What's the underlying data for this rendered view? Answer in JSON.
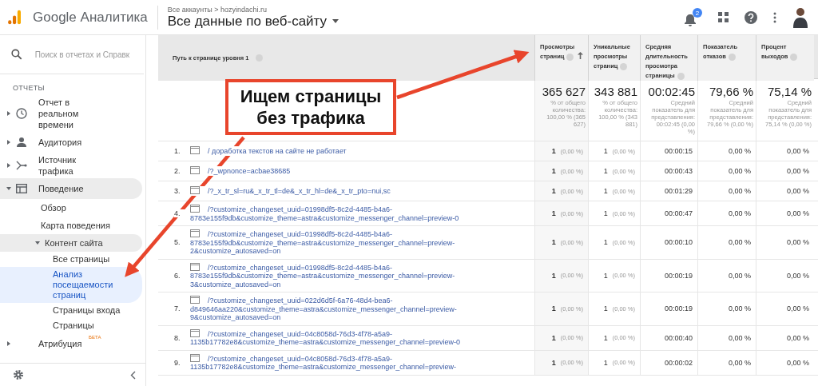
{
  "header": {
    "product": "Google Аналитика",
    "breadcrumb": "Все аккаунты > hozyindachi.ru",
    "view": "Все данные по веб-сайту",
    "notifications": "2"
  },
  "sidebar": {
    "search_placeholder": "Поиск в отчетах и Справк",
    "section": "ОТЧЕТЫ",
    "items": [
      {
        "label": "Отчет в реальном времени",
        "expanded": false,
        "selected": false
      },
      {
        "label": "Аудитория",
        "expanded": false,
        "selected": false
      },
      {
        "label": "Источник трафика",
        "expanded": false,
        "selected": false
      },
      {
        "label": "Поведение",
        "expanded": true,
        "selected": false,
        "children": [
          {
            "label": "Обзор",
            "expanded": false,
            "selected": false
          },
          {
            "label": "Карта поведения",
            "expanded": false,
            "selected": false
          },
          {
            "label": "Контент сайта",
            "expanded": true,
            "selected": false,
            "children": [
              {
                "label": "Все страницы",
                "selected": false
              },
              {
                "label": "Анализ посещаемости страниц",
                "selected": true
              },
              {
                "label": "Страницы входа",
                "selected": false
              },
              {
                "label": "Страницы",
                "selected": false
              }
            ]
          }
        ]
      },
      {
        "label": "Атрибуция",
        "badge": "БЕТА",
        "expanded": false,
        "selected": false
      }
    ]
  },
  "table": {
    "columns": [
      {
        "label": "Путь к странице уровня 1",
        "sorted": false
      },
      {
        "label": "Просмотры страниц",
        "sorted": true
      },
      {
        "label": "Уникальные просмотры страниц",
        "sorted": false
      },
      {
        "label": "Средняя длительность просмотра страницы",
        "sorted": false
      },
      {
        "label": "Показатель отказов",
        "sorted": false
      },
      {
        "label": "Процент выходов",
        "sorted": false
      }
    ],
    "totals": [
      {
        "value": "365 627",
        "note": "% от общего количества: 100,00 % (365 627)"
      },
      {
        "value": "343 881",
        "note": "% от общего количества: 100,00 % (343 881)"
      },
      {
        "value": "00:02:45",
        "note": "Средний показатель для представления: 00:02:45 (0,00 %)"
      },
      {
        "value": "79,66 %",
        "note": "Средний показатель для представления: 79,66 % (0,00 %)"
      },
      {
        "value": "75,14 %",
        "note": "Средний показатель для представления: 75,14 % (0,00 %)"
      }
    ],
    "rows": [
      {
        "index": "1.",
        "path": "/ доработка текстов на сайте не работает",
        "views": "1",
        "views_pct": "(0,00 %)",
        "unique": "1",
        "unique_pct": "(0,00 %)",
        "avg_time": "00:00:15",
        "bounce": "0,00 %",
        "exit": "0,00 %"
      },
      {
        "index": "2.",
        "path": "/?_wpnonce=acbae38685",
        "views": "1",
        "views_pct": "(0,00 %)",
        "unique": "1",
        "unique_pct": "(0,00 %)",
        "avg_time": "00:00:43",
        "bounce": "0,00 %",
        "exit": "0,00 %"
      },
      {
        "index": "3.",
        "path": "/?_x_tr_sl=ru&_x_tr_tl=de&_x_tr_hl=de&_x_tr_pto=nui,sc",
        "views": "1",
        "views_pct": "(0,00 %)",
        "unique": "1",
        "unique_pct": "(0,00 %)",
        "avg_time": "00:01:29",
        "bounce": "0,00 %",
        "exit": "0,00 %"
      },
      {
        "index": "4.",
        "path": "/?customize_changeset_uuid=01998df5-8c2d-4485-b4a6-8783e155f9db&customize_theme=astra&customize_messenger_channel=preview-0",
        "views": "1",
        "views_pct": "(0,00 %)",
        "unique": "1",
        "unique_pct": "(0,00 %)",
        "avg_time": "00:00:47",
        "bounce": "0,00 %",
        "exit": "0,00 %"
      },
      {
        "index": "5.",
        "path": "/?customize_changeset_uuid=01998df5-8c2d-4485-b4a6-8783e155f9db&customize_theme=astra&customize_messenger_channel=preview-2&customize_autosaved=on",
        "views": "1",
        "views_pct": "(0,00 %)",
        "unique": "1",
        "unique_pct": "(0,00 %)",
        "avg_time": "00:00:10",
        "bounce": "0,00 %",
        "exit": "0,00 %"
      },
      {
        "index": "6.",
        "path": "/?customize_changeset_uuid=01998df5-8c2d-4485-b4a6-8783e155f9db&customize_theme=astra&customize_messenger_channel=preview-3&customize_autosaved=on",
        "views": "1",
        "views_pct": "(0,00 %)",
        "unique": "1",
        "unique_pct": "(0,00 %)",
        "avg_time": "00:00:19",
        "bounce": "0,00 %",
        "exit": "0,00 %"
      },
      {
        "index": "7.",
        "path": "/?customize_changeset_uuid=022d6d5f-6a76-48d4-bea6-d849646aa220&customize_theme=astra&customize_messenger_channel=preview-9&customize_autosaved=on",
        "views": "1",
        "views_pct": "(0,00 %)",
        "unique": "1",
        "unique_pct": "(0,00 %)",
        "avg_time": "00:00:19",
        "bounce": "0,00 %",
        "exit": "0,00 %"
      },
      {
        "index": "8.",
        "path": "/?customize_changeset_uuid=04c8058d-76d3-4f78-a5a9-1135b17782e8&customize_theme=astra&customize_messenger_channel=preview-0",
        "views": "1",
        "views_pct": "(0,00 %)",
        "unique": "1",
        "unique_pct": "(0,00 %)",
        "avg_time": "00:00:40",
        "bounce": "0,00 %",
        "exit": "0,00 %"
      },
      {
        "index": "9.",
        "path": "/?customize_changeset_uuid=04c8058d-76d3-4f78-a5a9-1135b17782e8&customize_theme=astra&customize_messenger_channel=preview-",
        "views": "1",
        "views_pct": "(0,00 %)",
        "unique": "1",
        "unique_pct": "(0,00 %)",
        "avg_time": "00:00:02",
        "bounce": "0,00 %",
        "exit": "0,00 %"
      }
    ]
  },
  "annotation": {
    "lines": [
      "Ищем страницы",
      "без трафика"
    ]
  }
}
